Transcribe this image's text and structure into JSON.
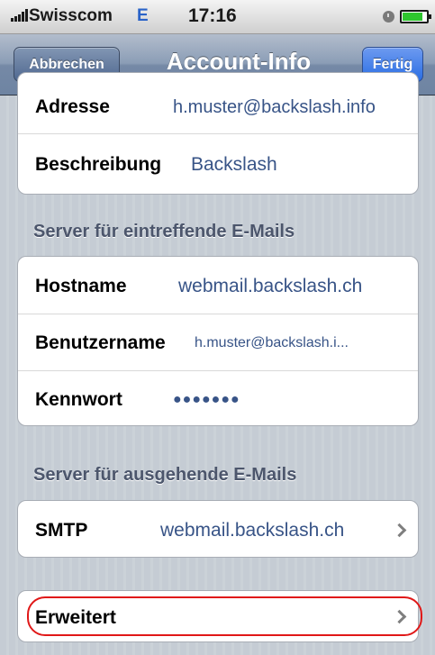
{
  "status_bar": {
    "carrier": "Swisscom",
    "network": "E",
    "time": "17:16",
    "battery_level": 0.85,
    "battery_color": "#2fc62f"
  },
  "nav": {
    "cancel_label": "Abbrechen",
    "title": "Account-Info",
    "done_label": "Fertig"
  },
  "account": {
    "address_label": "Adresse",
    "address_value": "h.muster@backslash.info",
    "description_label": "Beschreibung",
    "description_value": "Backslash"
  },
  "incoming": {
    "header": "Server für eintreffende E-Mails",
    "hostname_label": "Hostname",
    "hostname_value": "webmail.backslash.ch",
    "username_label": "Benutzername",
    "username_value": "h.muster@backslash.i...",
    "password_label": "Kennwort",
    "password_value": "●●●●●●●"
  },
  "outgoing": {
    "header": "Server für ausgehende E-Mails",
    "smtp_label": "SMTP",
    "smtp_value": "webmail.backslash.ch"
  },
  "advanced": {
    "label": "Erweitert"
  },
  "colors": {
    "highlight": "#e01818",
    "value_text": "#385487"
  }
}
